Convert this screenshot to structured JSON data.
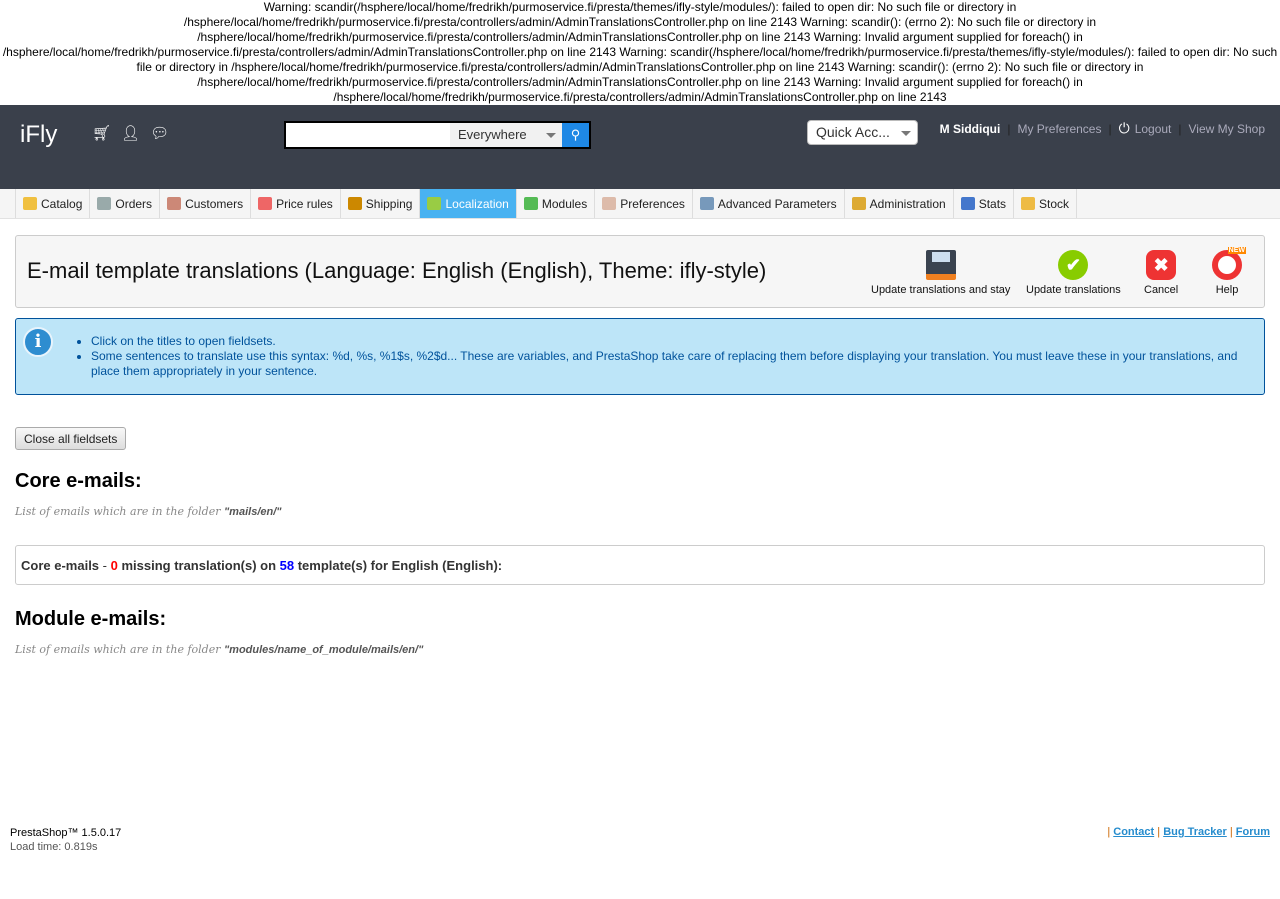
{
  "warnings": [
    "Warning: scandir(/hsphere/local/home/fredrikh/purmoservice.fi/presta/themes/ifly-style/modules/): failed to open dir: No such file or directory in /hsphere/local/home/fredrikh/purmoservice.fi/presta/controllers/admin/AdminTranslationsController.php on line 2143 Warning: scandir(): (errno 2): No such file or directory in /hsphere/local/home/fredrikh/purmoservice.fi/presta/controllers/admin/AdminTranslationsController.php on line 2143 Warning: Invalid argument supplied for foreach() in /hsphere/local/home/fredrikh/purmoservice.fi/presta/controllers/admin/AdminTranslationsController.php on line 2143 Warning: scandir(/hsphere/local/home/fredrikh/purmoservice.fi/presta/themes/ifly-style/modules/): failed to open dir: No such file or directory in /hsphere/local/home/fredrikh/purmoservice.fi/presta/controllers/admin/AdminTranslationsController.php on line 2143 Warning: scandir(): (errno 2): No such file or directory in /hsphere/local/home/fredrikh/purmoservice.fi/presta/controllers/admin/AdminTranslationsController.php on line 2143 Warning: Invalid argument supplied for foreach() in /hsphere/local/home/fredrikh/purmoservice.fi/presta/controllers/admin/AdminTranslationsController.php on line 2143"
  ],
  "header": {
    "logo": "iFly",
    "search_placeholder": "",
    "search_scope": "Everywhere",
    "quick_access": "Quick Acc...",
    "user": "M Siddiqui",
    "my_preferences": "My Preferences",
    "logout": "Logout",
    "view_shop": "View My Shop"
  },
  "nav": [
    {
      "label": "Catalog",
      "color": "#f0c040"
    },
    {
      "label": "Orders",
      "color": "#9aa"
    },
    {
      "label": "Customers",
      "color": "#c87"
    },
    {
      "label": "Price rules",
      "color": "#e66"
    },
    {
      "label": "Shipping",
      "color": "#c80"
    },
    {
      "label": "Localization",
      "color": "#9c4",
      "active": true
    },
    {
      "label": "Modules",
      "color": "#5b5"
    },
    {
      "label": "Preferences",
      "color": "#dba"
    },
    {
      "label": "Advanced Parameters",
      "color": "#79b"
    },
    {
      "label": "Administration",
      "color": "#da3"
    },
    {
      "label": "Stats",
      "color": "#47c"
    },
    {
      "label": "Stock",
      "color": "#eb4"
    }
  ],
  "toolbar": {
    "title": "E-mail template translations (Language: English (English), Theme: ifly-style)",
    "buttons": [
      "Update translations and stay",
      "Update translations",
      "Cancel",
      "Help"
    ],
    "help_badge": "NEW"
  },
  "info": {
    "items": [
      "Click on the titles to open fieldsets.",
      "Some sentences to translate use this syntax: %d, %s, %1$s, %2$d... These are variables, and PrestaShop take care of replacing them before displaying your translation. You must leave these in your translations, and place them appropriately in your sentence."
    ]
  },
  "close_fieldsets": "Close all fieldsets",
  "core": {
    "title": "Core e-mails:",
    "subtitle": "List of emails which are in the folder",
    "folder": "\"mails/en/\"",
    "fs_label": "Core e-mails",
    "fs_dash": " - ",
    "missing": "0",
    "fs_mid": " missing translation(s) on ",
    "templates": "58",
    "fs_end": " template(s) for English (English):"
  },
  "module": {
    "title": "Module e-mails:",
    "subtitle": "List of emails which are in the folder",
    "folder": "\"modules/name_of_module/mails/en/\""
  },
  "footer": {
    "version": "PrestaShop™ 1.5.0.17",
    "load_time": "Load time: 0.819s",
    "links": [
      "Contact",
      "Bug Tracker",
      "Forum"
    ]
  }
}
